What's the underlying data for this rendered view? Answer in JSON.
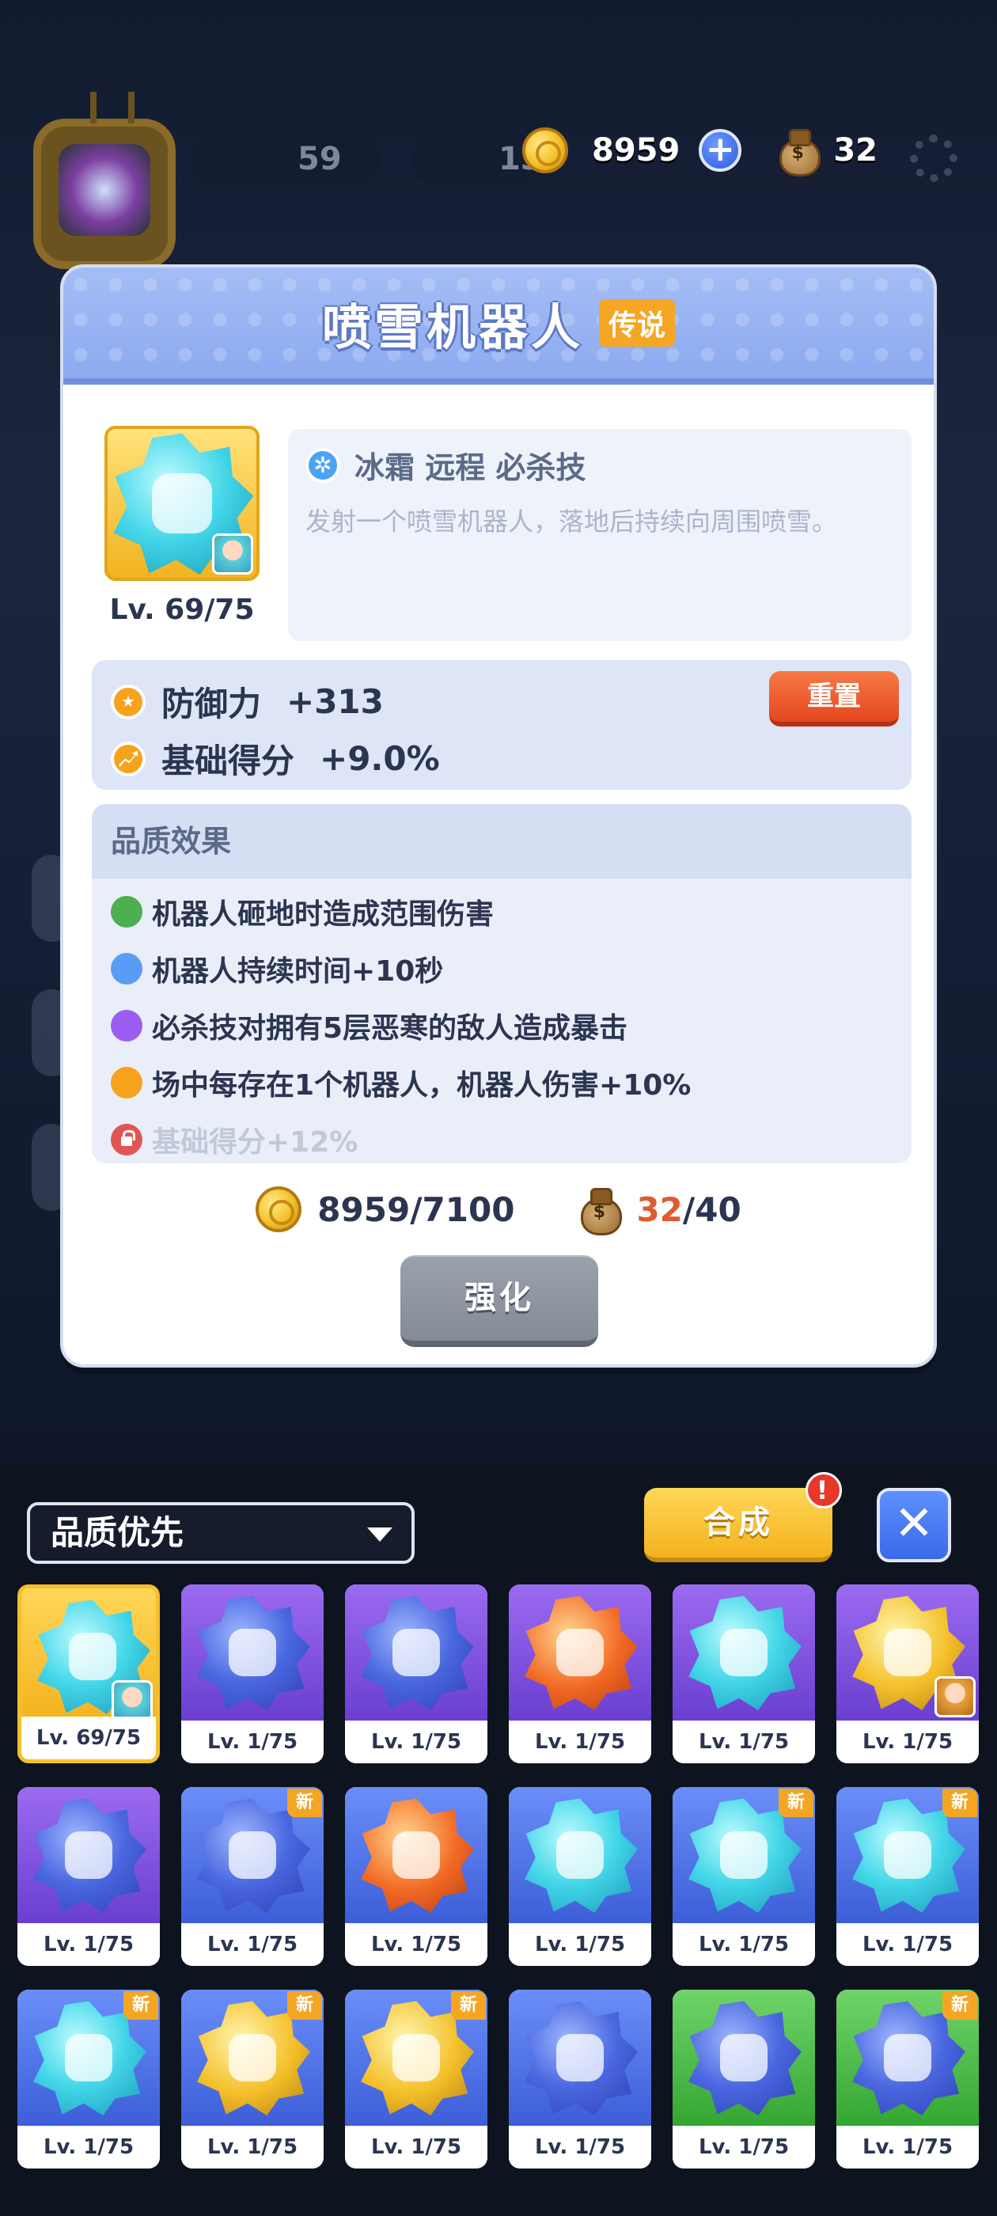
{
  "currency": {
    "coins": "8959",
    "bags": "32"
  },
  "background_scene": {
    "left_pill_value": "59",
    "mid_pill_value": "13"
  },
  "skill": {
    "name": "喷雪机器人",
    "rarity": "传说",
    "level": "Lv. 69/75",
    "tags": "冰霜 远程 必杀技",
    "description": "发射一个喷雪机器人，落地后持续向周围喷雪。"
  },
  "stats": [
    {
      "label": "防御力",
      "value": "+313"
    },
    {
      "label": "基础得分",
      "value": "+9.0%"
    }
  ],
  "reset_label": "重置",
  "quality": {
    "header": "品质效果",
    "effects": [
      {
        "text": "机器人砸地时造成范围伤害",
        "color": "#4caf50",
        "locked": false
      },
      {
        "text": "机器人持续时间+10秒",
        "color": "#5a9cf5",
        "locked": false
      },
      {
        "text": "必杀技对拥有5层恶寒的敌人造成暴击",
        "color": "#9b5cf0",
        "locked": false
      },
      {
        "text": "场中每存在1个机器人，机器人伤害+10%",
        "color": "#f7a21d",
        "locked": false
      },
      {
        "text": "基础得分+12%",
        "color": "#e25555",
        "locked": true
      }
    ]
  },
  "cost": {
    "coins_have": "8959",
    "coins_need": "/7100",
    "bags_have": "32",
    "bags_need": "/40"
  },
  "upgrade_label": "强化",
  "sort": {
    "selected": "品质优先"
  },
  "synth_label": "合成",
  "synth_alert": "!",
  "close_label": "✕",
  "cards": [
    {
      "level": "Lv. 69/75",
      "bg": "bg-gold",
      "star": "star-ice",
      "portrait": "ice",
      "new": false,
      "selected": true
    },
    {
      "level": "Lv. 1/75",
      "bg": "bg-purple",
      "star": "star-blue",
      "portrait": "",
      "new": false
    },
    {
      "level": "Lv. 1/75",
      "bg": "bg-purple",
      "star": "star-blue",
      "portrait": "",
      "new": false
    },
    {
      "level": "Lv. 1/75",
      "bg": "bg-purple",
      "star": "star-orange",
      "portrait": "",
      "new": false
    },
    {
      "level": "Lv. 1/75",
      "bg": "bg-purple",
      "star": "star-ice",
      "portrait": "",
      "new": false
    },
    {
      "level": "Lv. 1/75",
      "bg": "bg-purple",
      "star": "star-gold",
      "portrait": "gold",
      "new": false
    },
    {
      "level": "Lv. 1/75",
      "bg": "bg-purple",
      "star": "star-blue",
      "portrait": "",
      "new": false
    },
    {
      "level": "Lv. 1/75",
      "bg": "bg-blue",
      "star": "star-blue",
      "portrait": "",
      "new": true
    },
    {
      "level": "Lv. 1/75",
      "bg": "bg-blue",
      "star": "star-orange",
      "portrait": "",
      "new": false
    },
    {
      "level": "Lv. 1/75",
      "bg": "bg-blue",
      "star": "star-ice",
      "portrait": "",
      "new": false
    },
    {
      "level": "Lv. 1/75",
      "bg": "bg-blue",
      "star": "star-ice",
      "portrait": "",
      "new": true
    },
    {
      "level": "Lv. 1/75",
      "bg": "bg-blue",
      "star": "star-ice",
      "portrait": "",
      "new": true
    },
    {
      "level": "Lv. 1/75",
      "bg": "bg-blue",
      "star": "star-ice",
      "portrait": "",
      "new": true
    },
    {
      "level": "Lv. 1/75",
      "bg": "bg-blue",
      "star": "star-gold",
      "portrait": "",
      "new": true
    },
    {
      "level": "Lv. 1/75",
      "bg": "bg-blue",
      "star": "star-gold",
      "portrait": "",
      "new": true
    },
    {
      "level": "Lv. 1/75",
      "bg": "bg-blue",
      "star": "star-blue",
      "portrait": "",
      "new": false
    },
    {
      "level": "Lv. 1/75",
      "bg": "bg-green",
      "star": "star-blue",
      "portrait": "",
      "new": false
    },
    {
      "level": "Lv. 1/75",
      "bg": "bg-green",
      "star": "star-blue",
      "portrait": "",
      "new": true
    }
  ]
}
